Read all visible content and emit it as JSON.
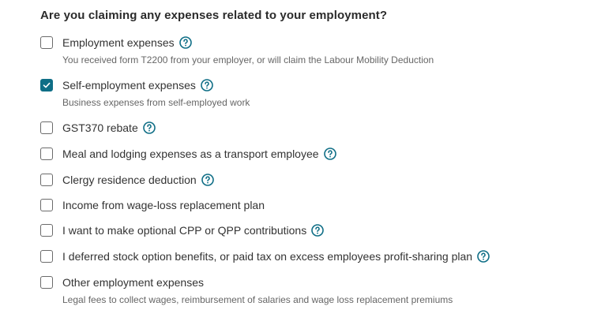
{
  "question": "Are you claiming any expenses related to your employment?",
  "options": [
    {
      "label": "Employment expenses",
      "description": "You received form T2200 from your employer, or will claim the Labour Mobility Deduction",
      "checked": false,
      "help": true
    },
    {
      "label": "Self-employment expenses",
      "description": "Business expenses from self-employed work",
      "checked": true,
      "help": true
    },
    {
      "label": "GST370 rebate",
      "checked": false,
      "help": true
    },
    {
      "label": "Meal and lodging expenses as a transport employee",
      "checked": false,
      "help": true
    },
    {
      "label": "Clergy residence deduction",
      "checked": false,
      "help": true
    },
    {
      "label": "Income from wage-loss replacement plan",
      "checked": false,
      "help": false
    },
    {
      "label": "I want to make optional CPP or QPP contributions",
      "checked": false,
      "help": true
    },
    {
      "label": "I deferred stock option benefits, or paid tax on excess employees profit-sharing plan",
      "checked": false,
      "help": true
    },
    {
      "label": "Other employment expenses",
      "description": "Legal fees to collect wages, reimbursement of salaries and wage loss replacement premiums",
      "checked": false,
      "help": false
    }
  ],
  "colors": {
    "accent": "#0f6e86",
    "help_icon": "#0f6e86"
  },
  "icons": {
    "help": "help-circle-icon",
    "check": "checkmark-icon"
  }
}
